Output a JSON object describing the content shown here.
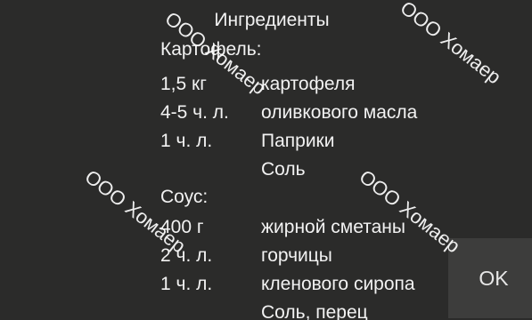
{
  "title": "Ингредиенты",
  "sections": [
    {
      "heading": "Картофель:",
      "rows": [
        {
          "qty": "1,5 кг",
          "name": "картофеля"
        },
        {
          "qty": "4-5 ч. л.",
          "name": "оливкового масла"
        },
        {
          "qty": "1 ч. л.",
          "name": "Паприки"
        },
        {
          "qty": "",
          "name": "Соль"
        }
      ]
    },
    {
      "heading": "Соус:",
      "rows": [
        {
          "qty": "400 г",
          "name": "жирной сметаны"
        },
        {
          "qty": "2 ч. л.",
          "name": "горчицы"
        },
        {
          "qty": "1 ч. л.",
          "name": "кленового сиропа"
        },
        {
          "qty": "",
          "name": "Соль, перец"
        }
      ]
    }
  ],
  "ok_label": "OK",
  "watermark": "ООО Хомаер",
  "colors": {
    "background": "#2b2b2a",
    "text": "#f2f2f2",
    "button": "#3d3d3c"
  }
}
